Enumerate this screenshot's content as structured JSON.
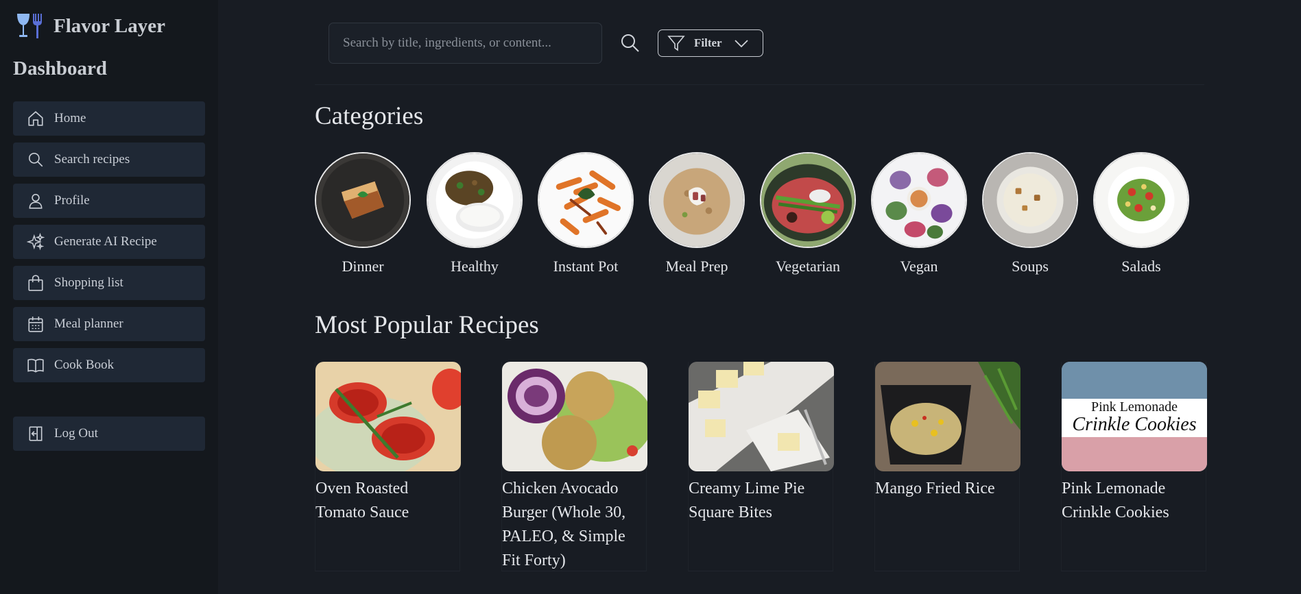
{
  "app": {
    "name": "Flavor Layer",
    "dashboard_title": "Dashboard"
  },
  "sidebar": {
    "items": [
      {
        "label": "Home",
        "icon": "home-icon"
      },
      {
        "label": "Search recipes",
        "icon": "search-icon"
      },
      {
        "label": "Profile",
        "icon": "user-icon"
      },
      {
        "label": "Generate AI Recipe",
        "icon": "sparkles-icon"
      },
      {
        "label": "Shopping list",
        "icon": "shopping-bag-icon"
      },
      {
        "label": "Meal planner",
        "icon": "calendar-icon"
      },
      {
        "label": "Cook Book",
        "icon": "book-icon"
      }
    ],
    "logout": {
      "label": "Log Out",
      "icon": "logout-icon"
    }
  },
  "search": {
    "placeholder": "Search by title, ingredients, or content...",
    "filter_label": "Filter"
  },
  "categories": {
    "title": "Categories",
    "items": [
      "Dinner",
      "Healthy",
      "Instant Pot",
      "Meal Prep",
      "Vegetarian",
      "Vegan",
      "Soups",
      "Salads"
    ]
  },
  "popular": {
    "title": "Most Popular Recipes",
    "items": [
      {
        "title": "Oven Roasted Tomato Sauce"
      },
      {
        "title": "Chicken Avocado Burger (Whole 30, PALEO, & Simple Fit Forty)"
      },
      {
        "title": "Creamy Lime Pie Square Bites"
      },
      {
        "title": "Mango Fried Rice"
      },
      {
        "title": "Pink Lemonade Crinkle Cookies",
        "image_text_line1": "Pink Lemonade",
        "image_text_line2": "Crinkle Cookies"
      }
    ]
  },
  "colors": {
    "background": "#181c23",
    "sidebar": "#14181d",
    "nav_item": "#1f2835",
    "text": "#e4e6ea"
  }
}
